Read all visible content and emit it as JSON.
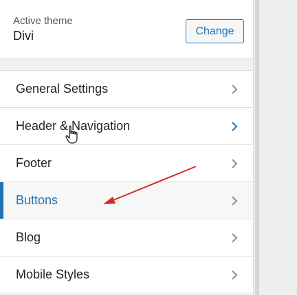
{
  "theme": {
    "label": "Active theme",
    "name": "Divi",
    "change_label": "Change"
  },
  "menu": {
    "items": [
      {
        "label": "General Settings",
        "chevron_color": "#8c8f94"
      },
      {
        "label": "Header & Navigation",
        "chevron_color": "#2271b1"
      },
      {
        "label": "Footer",
        "chevron_color": "#8c8f94"
      },
      {
        "label": "Buttons",
        "chevron_color": "#8c8f94"
      },
      {
        "label": "Blog",
        "chevron_color": "#8c8f94"
      },
      {
        "label": "Mobile Styles",
        "chevron_color": "#8c8f94"
      }
    ],
    "active_index": 3
  },
  "colors": {
    "accent": "#2271b1",
    "annotation_arrow": "#d42a2a"
  },
  "icons": {
    "chevron": "chevron-right-icon",
    "cursor": "hand-pointer-cursor-icon",
    "annotation": "red-arrow-annotation-icon"
  }
}
